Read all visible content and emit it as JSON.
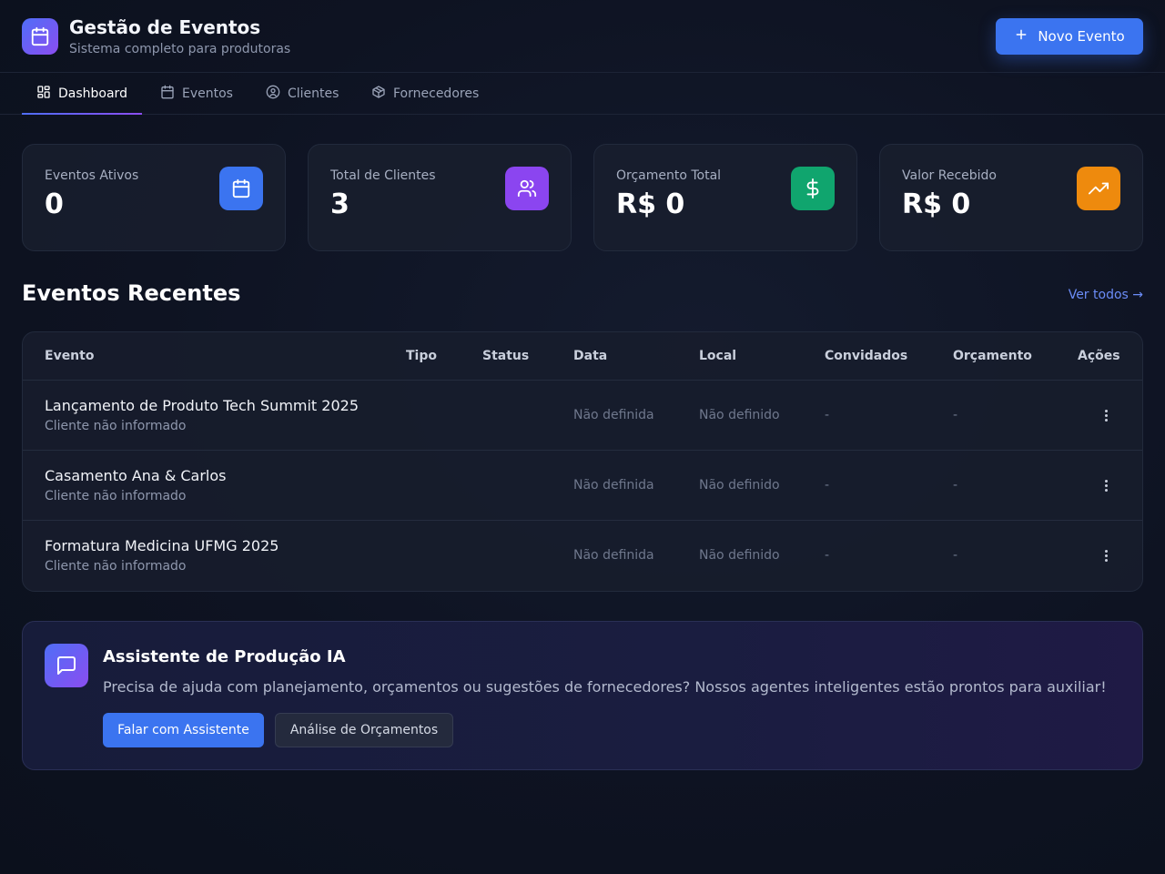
{
  "header": {
    "title": "Gestão de Eventos",
    "subtitle": "Sistema completo para produtoras",
    "new_event_label": "Novo Evento",
    "logo_icon": "calendar-icon"
  },
  "tabs": [
    {
      "label": "Dashboard",
      "icon": "dashboard-grid-icon",
      "active": true
    },
    {
      "label": "Eventos",
      "icon": "calendar-icon",
      "active": false
    },
    {
      "label": "Clientes",
      "icon": "user-circle-icon",
      "active": false
    },
    {
      "label": "Fornecedores",
      "icon": "package-icon",
      "active": false
    }
  ],
  "stats": [
    {
      "label": "Eventos Ativos",
      "value": "0",
      "icon": "calendar-icon",
      "color": "#3b74f0"
    },
    {
      "label": "Total de Clientes",
      "value": "3",
      "icon": "users-icon",
      "color": "#8b45f0"
    },
    {
      "label": "Orçamento Total",
      "value": "R$ 0",
      "icon": "dollar-icon",
      "color": "#10a56e"
    },
    {
      "label": "Valor Recebido",
      "value": "R$ 0",
      "icon": "trending-up-icon",
      "color": "#ee8a0d"
    }
  ],
  "recent": {
    "title": "Eventos Recentes",
    "see_all": "Ver todos →",
    "columns": [
      "Evento",
      "Tipo",
      "Status",
      "Data",
      "Local",
      "Convidados",
      "Orçamento",
      "Ações"
    ],
    "rows": [
      {
        "name": "Lançamento de Produto Tech Summit 2025",
        "client": "Cliente não informado",
        "type": "",
        "status": "",
        "date": "Não definida",
        "place": "Não definido",
        "guests": "-",
        "budget": "-"
      },
      {
        "name": "Casamento Ana & Carlos",
        "client": "Cliente não informado",
        "type": "",
        "status": "",
        "date": "Não definida",
        "place": "Não definido",
        "guests": "-",
        "budget": "-"
      },
      {
        "name": "Formatura Medicina UFMG 2025",
        "client": "Cliente não informado",
        "type": "",
        "status": "",
        "date": "Não definida",
        "place": "Não definido",
        "guests": "-",
        "budget": "-"
      }
    ]
  },
  "assistant": {
    "title": "Assistente de Produção IA",
    "text": "Precisa de ajuda com planejamento, orçamentos ou sugestões de fornecedores? Nossos agentes inteligentes estão prontos para auxiliar!",
    "primary_label": "Falar com Assistente",
    "secondary_label": "Análise de Orçamentos",
    "icon": "message-square-icon"
  }
}
